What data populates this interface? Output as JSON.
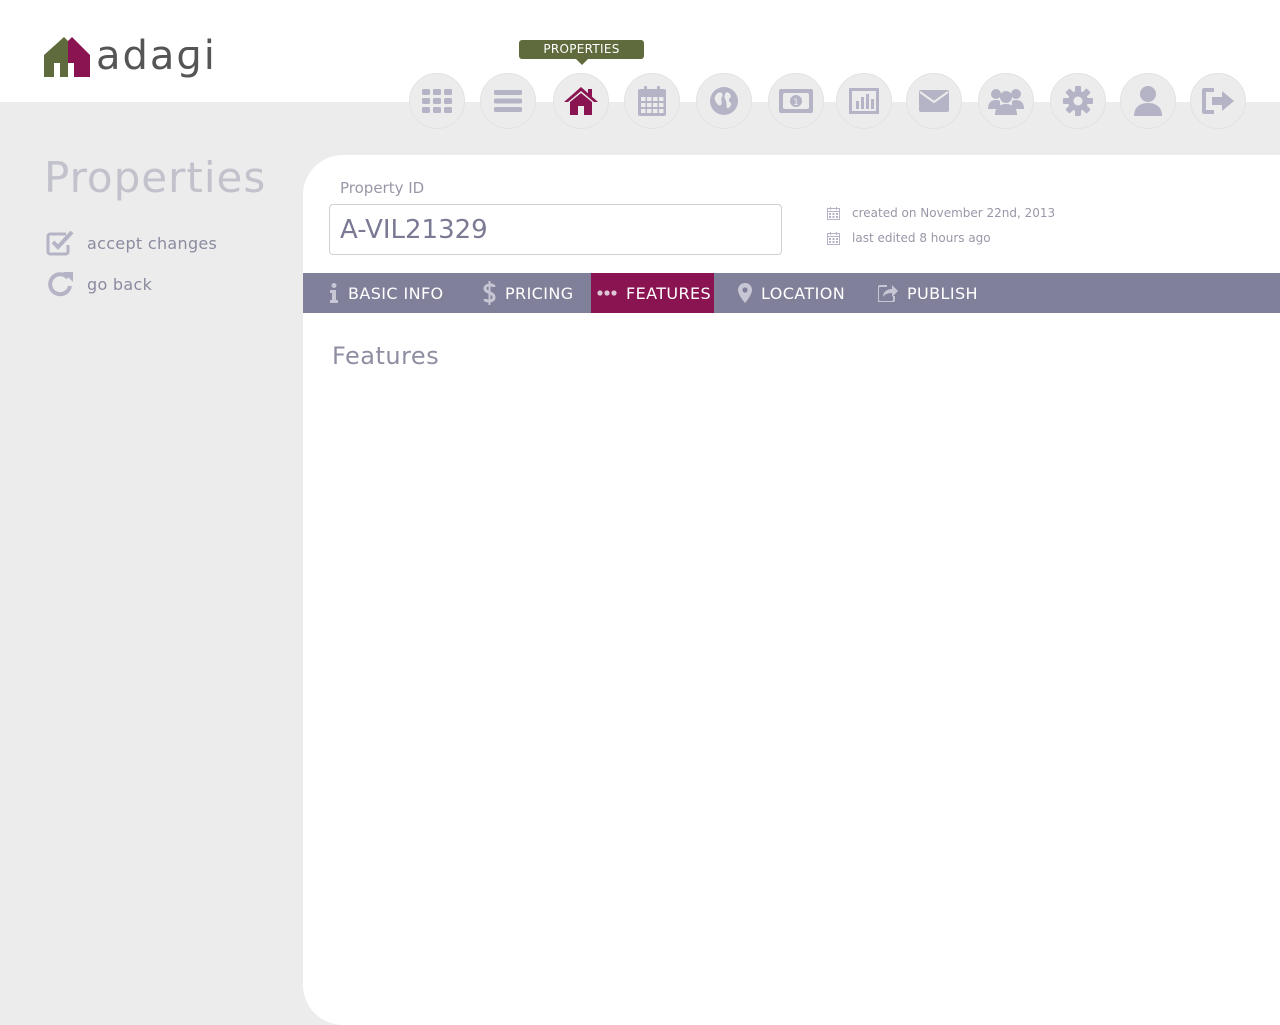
{
  "brand": {
    "name": "adaɡi"
  },
  "nav": {
    "tooltip": "PROPERTIES",
    "items": [
      {
        "icon": "dashboard-grid-icon",
        "active": false
      },
      {
        "icon": "list-icon",
        "active": false
      },
      {
        "icon": "home-icon",
        "active": true
      },
      {
        "icon": "calendar-icon",
        "active": false
      },
      {
        "icon": "globe-icon",
        "active": false
      },
      {
        "icon": "money-icon",
        "active": false
      },
      {
        "icon": "bar-chart-icon",
        "active": false
      },
      {
        "icon": "envelope-icon",
        "active": false
      },
      {
        "icon": "users-icon",
        "active": false
      },
      {
        "icon": "gear-icon",
        "active": false
      },
      {
        "icon": "user-icon",
        "active": false
      },
      {
        "icon": "sign-out-icon",
        "active": false
      }
    ]
  },
  "sidebar": {
    "title": "Properties",
    "actions": [
      {
        "label": "accept changes",
        "icon": "check-square-icon"
      },
      {
        "label": "go back",
        "icon": "refresh-icon"
      }
    ]
  },
  "form": {
    "property_id_label": "Property ID",
    "property_id_value": "A-VIL21329",
    "created": "created on November 22nd, 2013",
    "edited": "last edited 8 hours ago"
  },
  "tabs": [
    {
      "label": "BASIC INFO",
      "icon": "info-icon",
      "active": false
    },
    {
      "label": "PRICING",
      "icon": "dollar-icon",
      "active": false
    },
    {
      "label": "FEATURES",
      "icon": "ellipsis-icon",
      "active": true
    },
    {
      "label": "LOCATION",
      "icon": "map-marker-icon",
      "active": false
    },
    {
      "label": "PUBLISH",
      "icon": "share-icon",
      "active": false
    }
  ],
  "main": {
    "section_title": "Features"
  },
  "colors": {
    "accent": "#8a1452",
    "brand_green": "#5f6b3c",
    "tab_bar": "#80809a",
    "icon_gray": "#b4b4c6"
  }
}
